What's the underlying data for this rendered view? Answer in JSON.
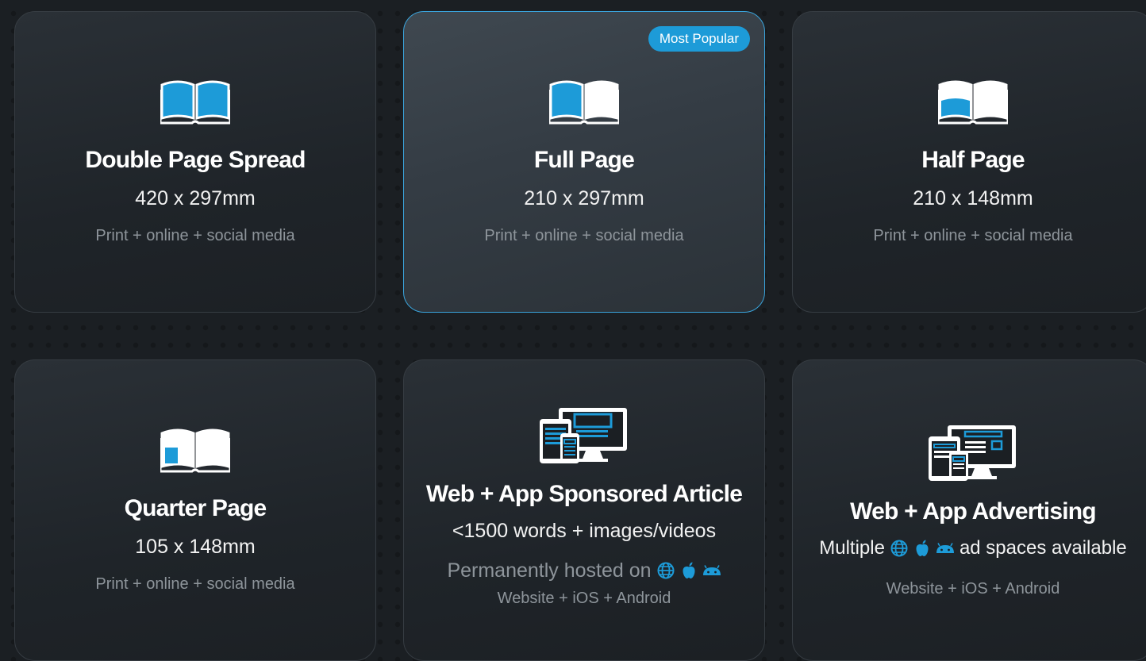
{
  "cards": [
    {
      "icon": "book-double-page-icon",
      "title": "Double Page Spread",
      "size": "420 x 297mm",
      "channels": "Print + online + social media"
    },
    {
      "icon": "book-full-page-icon",
      "badge": "Most Popular",
      "title": "Full Page",
      "size": "210 x 297mm",
      "channels": "Print + online + social media"
    },
    {
      "icon": "book-half-page-icon",
      "title": "Half Page",
      "size": "210 x 148mm",
      "channels": "Print + online + social media"
    },
    {
      "icon": "book-quarter-page-icon",
      "title": "Quarter Page",
      "size": "105 x 148mm",
      "channels": "Print + online + social media"
    },
    {
      "icon": "devices-icon",
      "title": "Web + App Sponsored Article",
      "size": "<1500 words + images/videos",
      "hosted": "Permanently hosted on",
      "platform_icons": [
        "globe-icon",
        "apple-icon",
        "android-icon"
      ],
      "platforms": "Website + iOS + Android"
    },
    {
      "icon": "devices-icon",
      "title": "Web + App Advertising",
      "size_prefix": "Multiple",
      "platform_icons": [
        "globe-icon",
        "apple-icon",
        "android-icon"
      ],
      "size_suffix": "ad spaces available",
      "platforms": "Website + iOS + Android"
    }
  ],
  "colors": {
    "accent": "#1d9bd8",
    "background": "#1b1f23",
    "muted_text": "#8e959b"
  }
}
